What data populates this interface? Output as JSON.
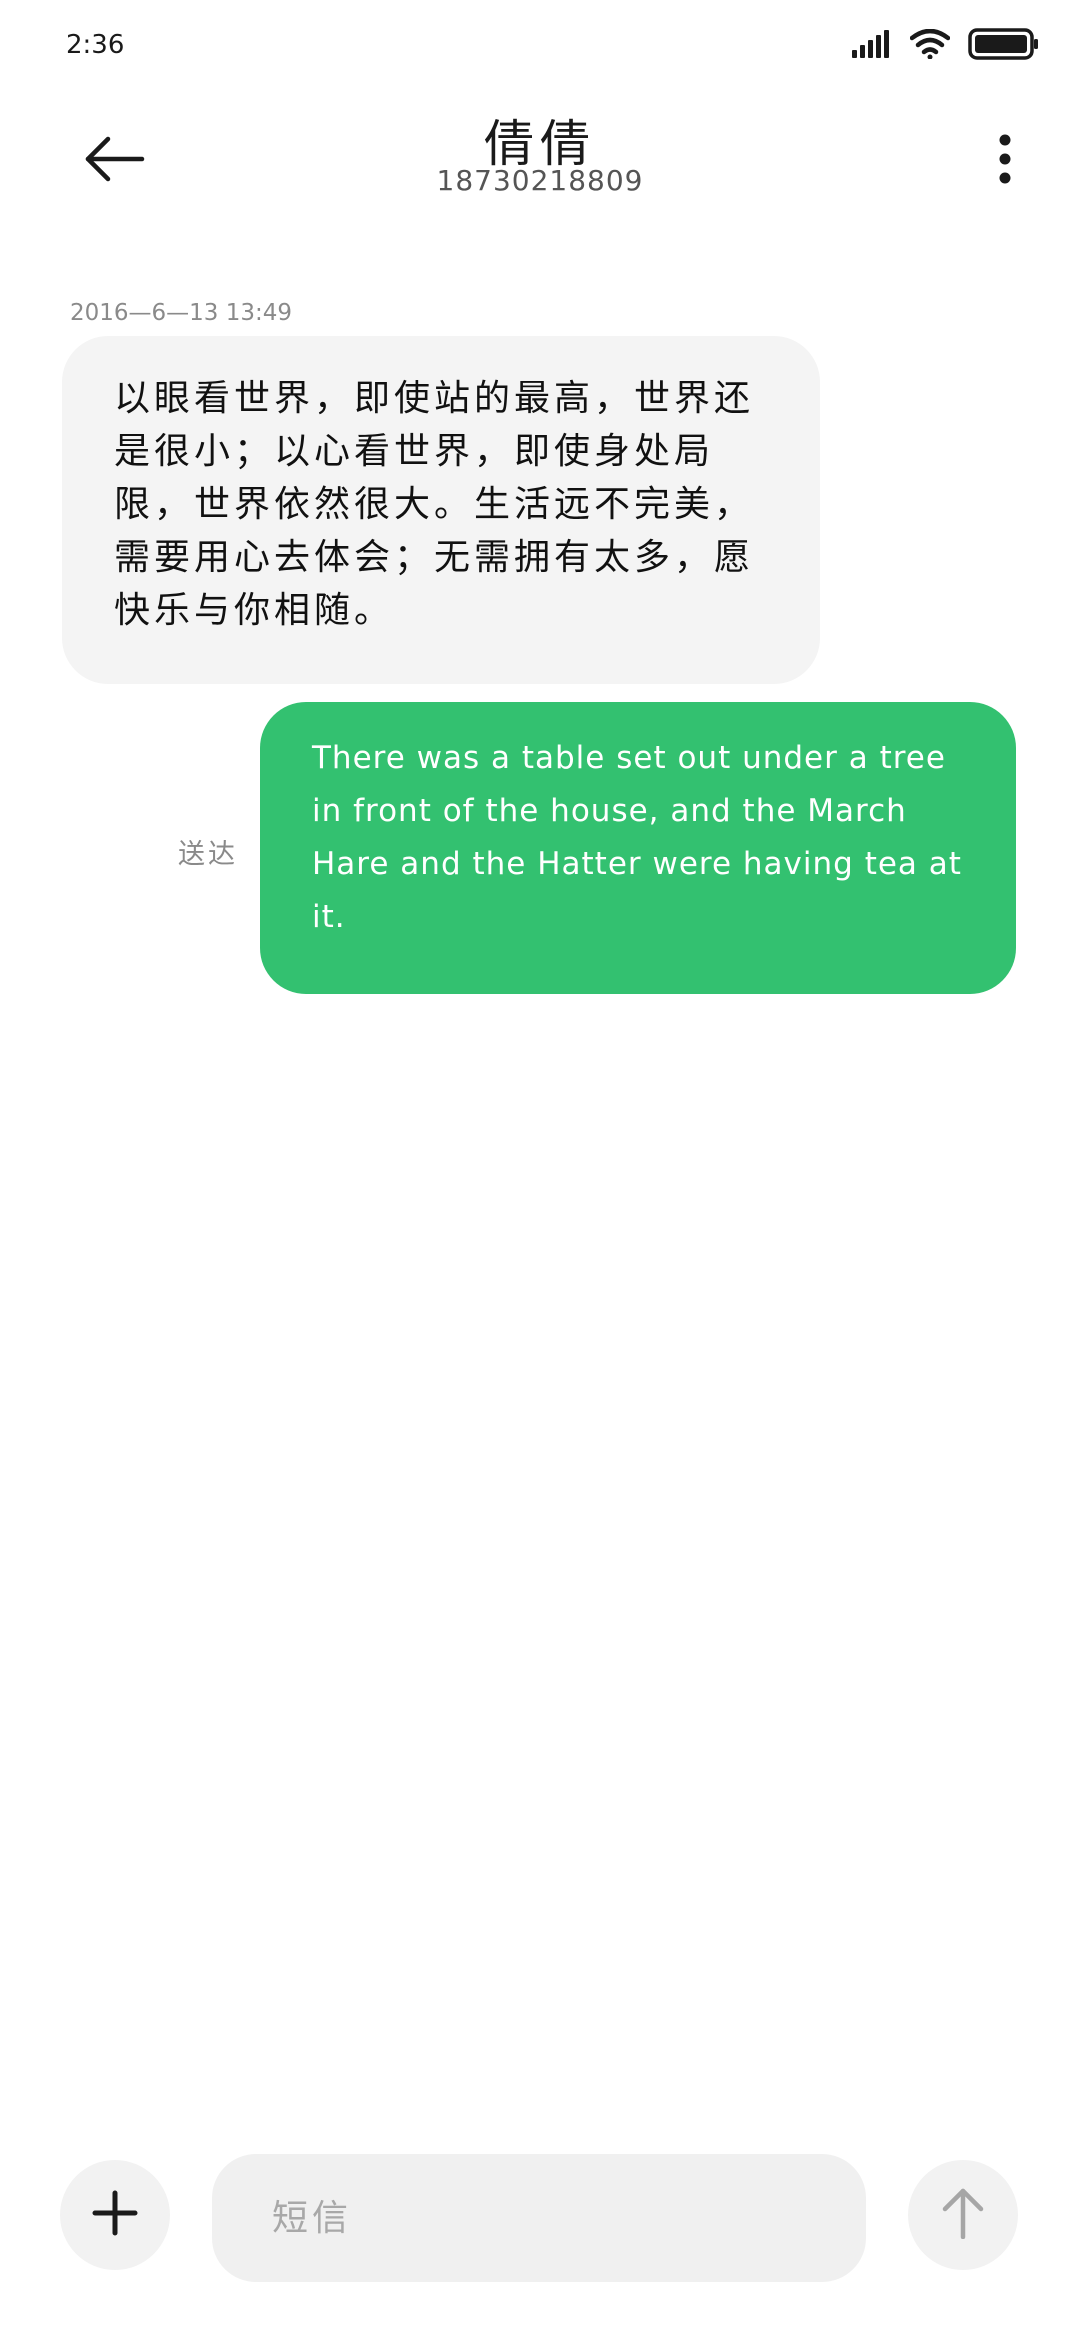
{
  "status_bar": {
    "time": "2:36",
    "icons": [
      "signal-icon",
      "wifi-icon",
      "battery-icon"
    ]
  },
  "header": {
    "contact_name": "倩倩",
    "contact_number": "18730218809",
    "icons": [
      "back-arrow-icon",
      "more-vertical-icon"
    ]
  },
  "messages": [
    {
      "direction": "received",
      "timestamp": "2016—6—13 13:49",
      "text": "以眼看世界，即使站的最高，世界还是很小；以心看世界，即使身处局限，世界依然很大。生活远不完美，需要用心去体会；无需拥有太多，愿快乐与你相随。"
    },
    {
      "direction": "sent",
      "status": "送达",
      "text": "There was a table set out under a tree in front of the house, and the March Hare and the Hatter were having tea at it."
    }
  ],
  "composer": {
    "placeholder": "短信",
    "icons": [
      "plus-icon",
      "send-arrow-up-icon"
    ]
  },
  "colors": {
    "sent_bubble": "#33c170",
    "received_bubble": "#f4f4f4",
    "background": "#ffffff"
  }
}
